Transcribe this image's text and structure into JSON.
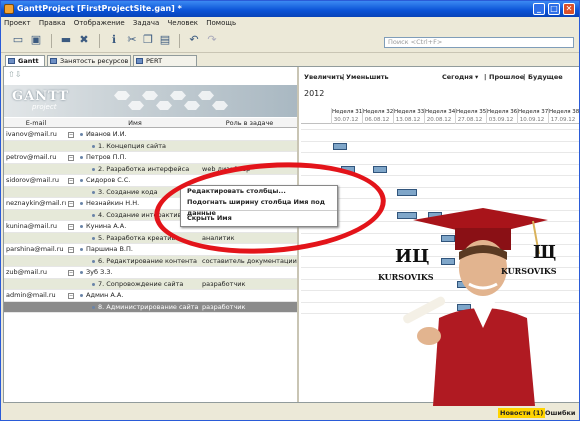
{
  "window": {
    "title": "GanttProject [FirstProjectSite.gan] *",
    "minimize": "_",
    "maximize": "□",
    "close": "✕"
  },
  "menu": [
    "Проект",
    "Правка",
    "Отображение",
    "Задача",
    "Человек",
    "Помощь"
  ],
  "search": {
    "placeholder": "Поиск <Ctrl+F>"
  },
  "tabs": [
    {
      "label": "Gantt"
    },
    {
      "label": "Занятость ресурсов"
    },
    {
      "label": "PERT диаграмма"
    }
  ],
  "logo": {
    "title": "GANTT",
    "subtitle": "project"
  },
  "columns": {
    "email": "E-mail",
    "name": "Имя",
    "role": "Роль в задаче"
  },
  "rows": [
    {
      "email": "ivanov@mail.ru",
      "name": "Иванов И.И.",
      "role": "",
      "kind": "person"
    },
    {
      "email": "",
      "name": "1. Концепция сайта",
      "role": "",
      "kind": "task"
    },
    {
      "email": "petrov@mail.ru",
      "name": "Петров П.П.",
      "role": "",
      "kind": "person"
    },
    {
      "email": "",
      "name": "2. Разработка интерфейса",
      "role": "web дизайнер",
      "kind": "task"
    },
    {
      "email": "sidorov@mail.ru",
      "name": "Сидоров С.С.",
      "role": "",
      "kind": "person"
    },
    {
      "email": "",
      "name": "3. Создание кода",
      "role": "",
      "kind": "task"
    },
    {
      "email": "neznaykin@mail.ru",
      "name": "Незнайкин Н.Н.",
      "role": "",
      "kind": "person"
    },
    {
      "email": "",
      "name": "4. Создание интерактивных э...",
      "role": "разработчик",
      "kind": "task"
    },
    {
      "email": "kunina@mail.ru",
      "name": "Кунина А.А.",
      "role": "",
      "kind": "person"
    },
    {
      "email": "",
      "name": "5. Разработка креатива",
      "role": "аналитик",
      "kind": "task"
    },
    {
      "email": "parshina@mail.ru",
      "name": "Паршина В.П.",
      "role": "",
      "kind": "person"
    },
    {
      "email": "",
      "name": "6. Редактирование контента",
      "role": "составитель документации",
      "kind": "task"
    },
    {
      "email": "zub@mail.ru",
      "name": "Зуб З.З.",
      "role": "",
      "kind": "person"
    },
    {
      "email": "",
      "name": "7. Сопровождение сайта",
      "role": "разработчик",
      "kind": "task"
    },
    {
      "email": "admin@mail.ru",
      "name": "Админ А.А.",
      "role": "",
      "kind": "person"
    },
    {
      "email": "",
      "name": "8. Администрирование сайта",
      "role": "разработчик",
      "kind": "task",
      "selected": true
    }
  ],
  "context_menu": {
    "item1": "Редактировать столбцы...",
    "item2": "Подогнать ширину столбца Имя под данные",
    "item3": "Скрыть Имя"
  },
  "chart_toolbar": {
    "zoom_in": "Увеличить",
    "zoom_out": "Уменьшить",
    "today": "Сегодня",
    "past": "Прошлое",
    "future": "Будущее"
  },
  "year": "2012",
  "weeks": [
    {
      "label": "Неделя 31",
      "date": "30.07.12"
    },
    {
      "label": "Неделя 32",
      "date": "06.08.12"
    },
    {
      "label": "Неделя 33",
      "date": "13.08.12"
    },
    {
      "label": "Неделя 34",
      "date": "20.08.12"
    },
    {
      "label": "Неделя 35",
      "date": "27.08.12"
    },
    {
      "label": "Неделя 36",
      "date": "03.09.12"
    },
    {
      "label": "Неделя 37",
      "date": "10.09.12"
    },
    {
      "label": "Неделя 38",
      "date": "17.09.12"
    }
  ],
  "promo": {
    "left_big": "ИЦ",
    "left_word": "KURSOVIKS",
    "right_big": "Щ",
    "right_word": "KURSOVIKS"
  },
  "status": {
    "news": "Новости (1)",
    "errors": "Ошибки"
  },
  "colors": {
    "title_bar": "#0a52d6",
    "task_bar": "#7fa6c9",
    "annotation_ring": "#e3141a",
    "selected_row": "#8b8b8b",
    "news_badge": "#ffd400"
  }
}
